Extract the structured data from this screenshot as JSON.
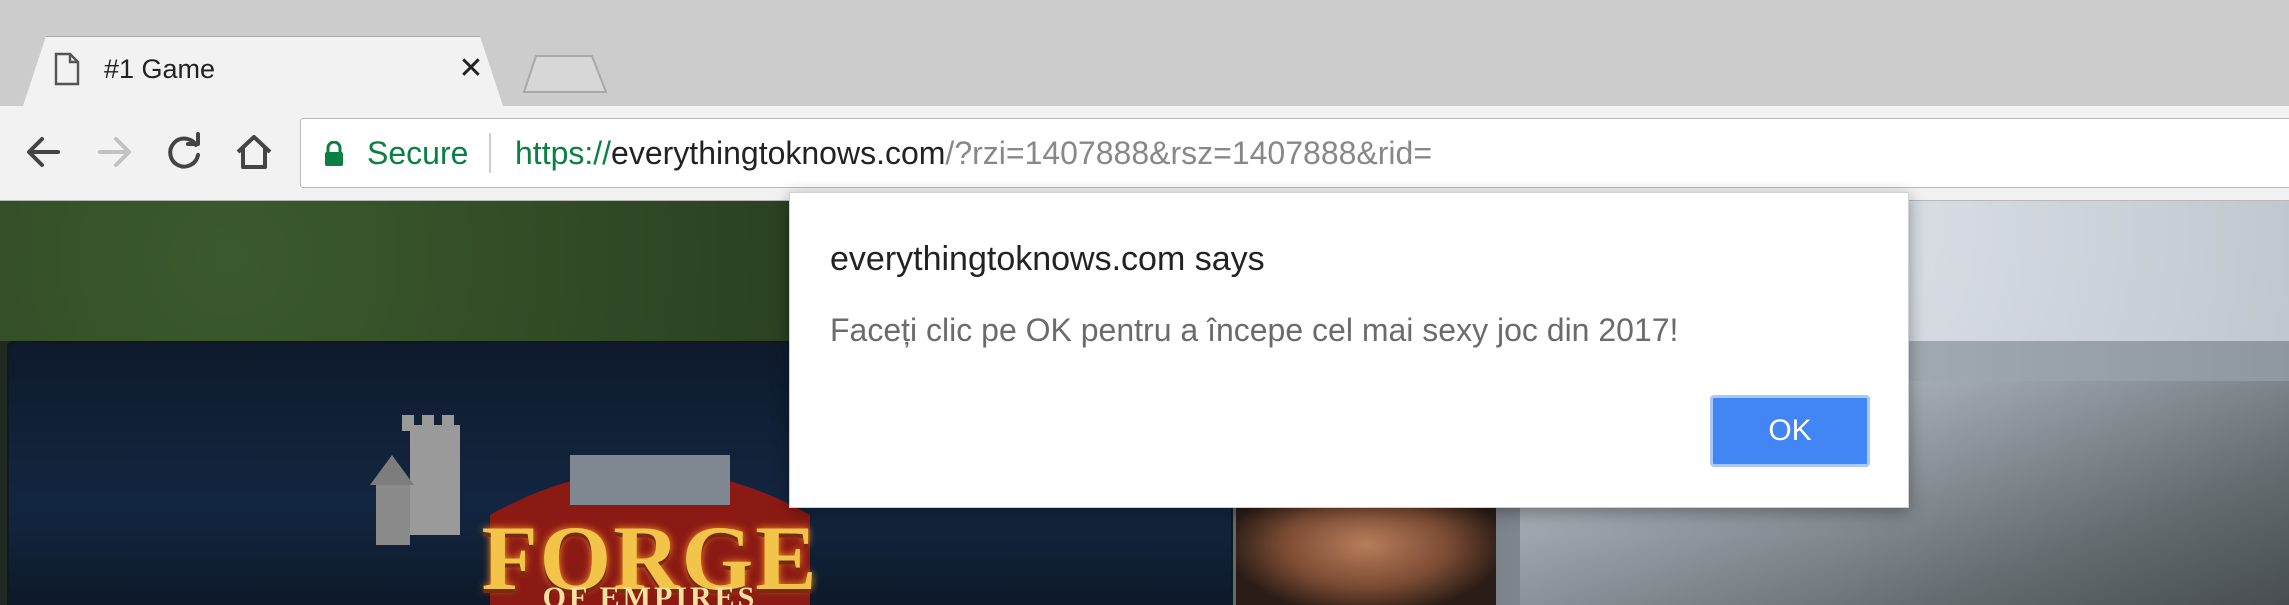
{
  "browser": {
    "tab": {
      "title": "#1 Game",
      "close_glyph": "✕",
      "icon": "page-icon"
    },
    "toolbar": {
      "back_icon": "back-arrow-icon",
      "forward_icon": "forward-arrow-icon",
      "reload_icon": "reload-icon",
      "home_icon": "home-icon"
    },
    "omnibox": {
      "security_label": "Secure",
      "url_scheme": "https://",
      "url_host": "everythingtoknows.com",
      "url_path": "/?rzi=1407888&rsz=1407888&rid="
    }
  },
  "page": {
    "logo_title": "FORGE",
    "logo_subtitle": "OF EMPIRES"
  },
  "dialog": {
    "title": "everythingtoknows.com says",
    "message": "Faceți clic pe OK pentru a începe cel mai sexy joc din 2017!",
    "ok_label": "OK"
  },
  "colors": {
    "secure_green": "#0b8043",
    "ok_button": "#4285f4"
  }
}
